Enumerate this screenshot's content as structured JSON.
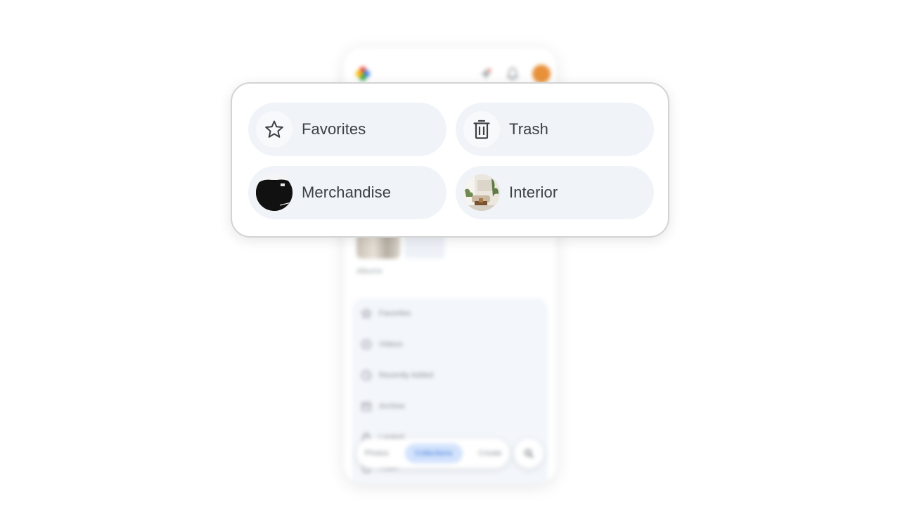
{
  "background_app": {
    "albums_label": "Albums",
    "list_items": [
      {
        "label": "Favorites",
        "icon": "star-icon"
      },
      {
        "label": "Videos",
        "icon": "play-circle-icon"
      },
      {
        "label": "Recently Added",
        "icon": "clock-icon"
      },
      {
        "label": "Archive",
        "icon": "archive-icon"
      },
      {
        "label": "Locked",
        "icon": "lock-icon"
      },
      {
        "label": "Trash",
        "icon": "trash-icon"
      }
    ],
    "bottom_nav": {
      "photos": "Photos",
      "collections": "Collections",
      "create": "Create"
    },
    "avatar_color": "#e8913a"
  },
  "popup": {
    "items": [
      {
        "label": "Favorites",
        "icon": "star-icon"
      },
      {
        "label": "Trash",
        "icon": "trash-icon"
      },
      {
        "label": "Merchandise",
        "icon": "album-thumbnail-black-shirt"
      },
      {
        "label": "Interior",
        "icon": "album-thumbnail-living-room"
      }
    ]
  },
  "colors": {
    "pill_bg": "#f0f3f8",
    "text": "#3c4043",
    "active_nav": "#d3e3fd"
  }
}
